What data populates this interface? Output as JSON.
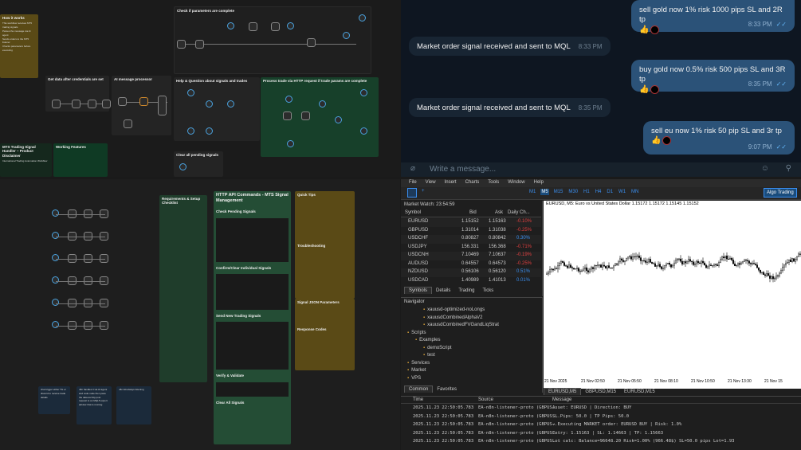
{
  "q1": {
    "notes": {
      "how": {
        "title": "How it works",
        "lines": [
          "This workflow receives MT5 trading signals",
          "Parses the message via AI agent",
          "Sends orders to the MT5 listener",
          "Checks parameters before executing"
        ]
      },
      "disclaimer": {
        "title": "MTS Trading Signal Handler – Product Disclaimer",
        "sub": "International Trading Automation Workflow"
      },
      "working": {
        "title": "Working Features"
      },
      "startafter": {
        "title": "Get data after credentials are set"
      },
      "aimsg": {
        "title": "AI message processor"
      },
      "help": {
        "title": "Help & Question about signals and trades"
      },
      "check2": {
        "title": "Check if parameters are complete"
      },
      "process": {
        "title": "Process trade via HTTP request if trade params are complete"
      },
      "clear": {
        "title": "Clear all pending signals"
      }
    }
  },
  "telegram": {
    "messages": [
      {
        "dir": "out",
        "text": "sell gold now 1% risk 1000 pips SL and 2R tp",
        "time": "8:33 PM"
      },
      {
        "dir": "in",
        "text": "Market order signal received and sent to MQL",
        "time": "8:33 PM"
      },
      {
        "dir": "out",
        "text": "buy gold now 0.5% risk 500 pips SL and 3R tp",
        "time": "8:35 PM"
      },
      {
        "dir": "in",
        "text": "Market order signal received and sent to MQL",
        "time": "8:35 PM"
      },
      {
        "dir": "out",
        "text": "sell eu now 1% risk 50 pip SL and 3r tp",
        "time": "9:07 PM"
      }
    ],
    "input_placeholder": "Write a message..."
  },
  "q3": {
    "req_title": "Requirements & Setup Checklist",
    "api_title": "HTTP API Commands - MTS Signal Management",
    "sections": [
      "Check Pending Signals",
      "Confirm/Clear Individual Signals",
      "Send New Trading Signals",
      "Verify & Validate",
      "Clear All Signals"
    ],
    "quick_tips": "Quick Tips",
    "troubleshooting": "Troubleshooting",
    "json_params": "Signal JSON Parameters",
    "response_codes": "Response Codes",
    "bottom_notes": [
      "chat trigger either TG or discord to receive trade details",
      "n8n handles it via AI agent and code node then pass the data as http post request to an MQL5 expert advisor that is running",
      "n8n EA always listening"
    ]
  },
  "mt5": {
    "menu": [
      "File",
      "View",
      "Insert",
      "Charts",
      "Tools",
      "Window",
      "Help"
    ],
    "timeframes": [
      "M1",
      "M5",
      "M15",
      "M30",
      "H1",
      "H4",
      "D1",
      "W1",
      "MN"
    ],
    "algo": "Algo Trading",
    "watch_title": "Market Watch: 23:54:59",
    "watch_headers": [
      "Symbol",
      "Bid",
      "Ask",
      "Daily Ch..."
    ],
    "watch_rows": [
      [
        "EURUSD",
        "1.15152",
        "1.15163",
        "-0.10%"
      ],
      [
        "GBPUSD",
        "1.31014",
        "1.31038",
        "-0.25%"
      ],
      [
        "USDCHF",
        "0.80827",
        "0.80842",
        "0.30%"
      ],
      [
        "USDJPY",
        "156.331",
        "156.368",
        "-0.71%"
      ],
      [
        "USDCNH",
        "7.10469",
        "7.10637",
        "-0.19%"
      ],
      [
        "AUDUSD",
        "0.64557",
        "0.64573",
        "-0.25%"
      ],
      [
        "NZDUSD",
        "0.56106",
        "0.56120",
        "0.51%"
      ],
      [
        "USDCAD",
        "1.40989",
        "1.41013",
        "0.01%"
      ]
    ],
    "watch_tabs": [
      "Symbols",
      "Details",
      "Trading",
      "Ticks"
    ],
    "nav_title": "Navigator",
    "nav_items": [
      "xauusd-optimized-noLongs",
      "xauusdCombinedAlphaV2",
      "xauusdCombinedFVGandLiqStrat",
      "Scripts",
      "Examples",
      "demoScript",
      "test",
      "Services",
      "Market",
      "VPS"
    ],
    "nav_tabs": [
      "Common",
      "Favorites"
    ],
    "chart_header": "EURUSD, M5:  Euro vs United States Dollar  1.15172 1.15172 1.15145 1.15152",
    "chart_x_labels": [
      "21 Nov 2025",
      "21 Nov 02:50",
      "21 Nov 05:50",
      "21 Nov 08:10",
      "21 Nov 10:50",
      "21 Nov 13:30",
      "21 Nov 15"
    ],
    "chart_tabs": [
      "EURUSD,M5",
      "GBPUSD,M15",
      "EURUSD,M15"
    ],
    "log_headers": [
      "Time",
      "Source",
      "Message"
    ],
    "log_rows": [
      [
        "2025.11.23 22:50:05.783",
        "EA-n8n-listener-proto (GBPUS...",
        "Asset: EURUSD | Direction: BUY"
      ],
      [
        "2025.11.23 22:50:05.783",
        "EA-n8n-listener-proto (GBPUS...",
        "SL Pips: 50.0 | TP Pips: 50.0"
      ],
      [
        "2025.11.23 22:50:05.783",
        "EA-n8n-listener-proto (GBPUS...",
        "→ Executing MARKET order: EURUSD BUY | Risk: 1.0%"
      ],
      [
        "2025.11.23 22:50:05.783",
        "EA-n8n-listener-proto (GBPUS...",
        "Entry: 1.15163 | SL: 1.14663 | TP: 1.15663"
      ],
      [
        "2025.11.23 22:50:05.783",
        "EA-n8n-listener-proto (GBPUS...",
        "Lot calc: Balance=96648.20 Risk=1.00% (966.48$) SL=50.0 pips Lot=1.93"
      ]
    ]
  }
}
